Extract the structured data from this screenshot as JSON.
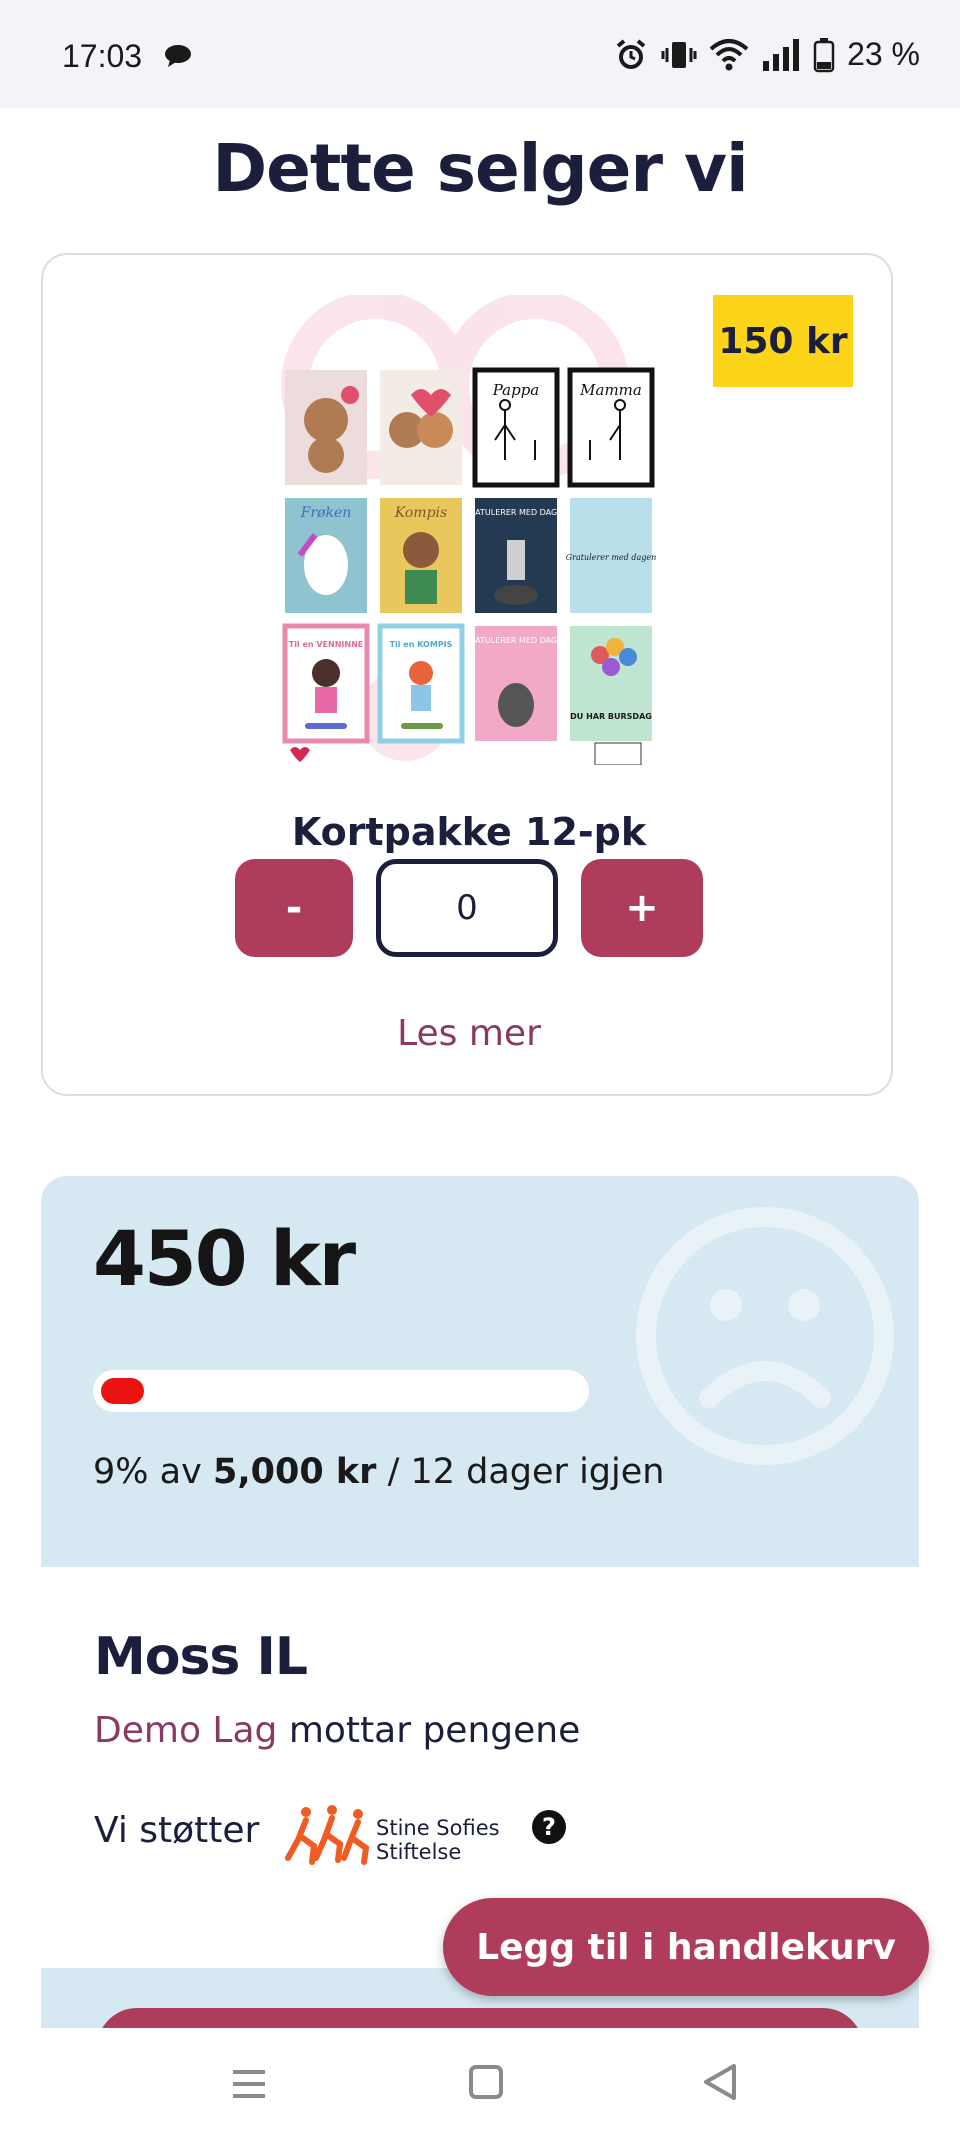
{
  "status_bar": {
    "time": "17:03",
    "battery": "23 %",
    "icons": [
      "chat-bubble-icon",
      "alarm-icon",
      "vibrate-icon",
      "wifi-icon",
      "signal-icon",
      "battery-icon"
    ]
  },
  "page": {
    "title": "Dette selger vi"
  },
  "product": {
    "price_badge": "150 kr",
    "name": "Kortpakke 12-pk",
    "quantity": "0",
    "minus_label": "-",
    "plus_label": "+",
    "read_more": "Les mer",
    "image_card_texts": [
      "Pappa",
      "Mamma",
      "Frøken",
      "Kompis",
      "GRATULERER MED DAGEN",
      "Gratulerer med dagen",
      "Til en VENNINNE",
      "Til en KOMPIS",
      "GRATULERER MED DAGEN",
      "DU HAR BURSDAG"
    ]
  },
  "fundraising": {
    "amount": "450 kr",
    "percent": "9%",
    "of_text": "av",
    "goal": "5,000 kr",
    "days_left": "/ 12 dager igjen",
    "progress_fraction": 0.09,
    "progress_color": "#ec1212",
    "panel_color": "#d6e8f1"
  },
  "organisation": {
    "name": "Moss IL",
    "recipient_name": "Demo Lag",
    "recipient_suffix": " mottar pengene",
    "supports_label": "Vi støtter",
    "charity_line1": "Stine Sofies",
    "charity_line2": "Stiftelse",
    "help_symbol": "?"
  },
  "cart": {
    "add_label": "Legg til i handlekurv"
  },
  "colors": {
    "brand": "#b03c5c",
    "badge": "#fcd419",
    "text": "#1b1f3b",
    "link": "#8a3a62"
  }
}
